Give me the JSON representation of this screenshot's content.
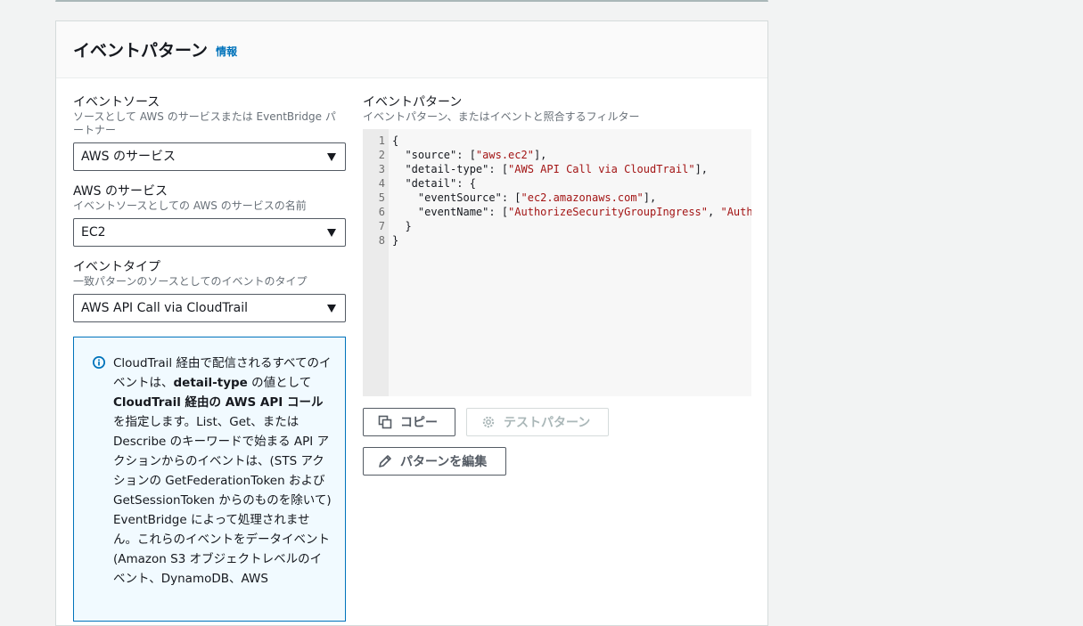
{
  "panel": {
    "title": "イベントパターン",
    "info_link": "情報"
  },
  "event_source": {
    "label": "イベントソース",
    "description": "ソースとして AWS のサービスまたは EventBridge パートナー",
    "value": "AWS のサービス"
  },
  "aws_service": {
    "label": "AWS のサービス",
    "description": "イベントソースとしての AWS のサービスの名前",
    "value": "EC2"
  },
  "event_type": {
    "label": "イベントタイプ",
    "description": "一致パターンのソースとしてのイベントのタイプ",
    "value": "AWS API Call via CloudTrail"
  },
  "info_box": {
    "parts": [
      "CloudTrail 経由で配信されるすべてのイベントは、",
      "detail-type",
      " の値として ",
      "CloudTrail 経由の AWS API コール",
      "を指定します。List、Get、または Describe のキーワードで始まる API アクションからのイベントは、(STS アクションの GetFederationToken および GetSessionToken からのものを除いて) EventBridge によって処理されません。これらのイベントをデータイベント (Amazon S3 オブジェクトレベルのイベント、DynamoDB、AWS"
    ]
  },
  "pattern": {
    "label": "イベントパターン",
    "description": "イベントパターン、またはイベントと照合するフィルター",
    "line_numbers": [
      "1",
      "2",
      "3",
      "4",
      "5",
      "6",
      "7",
      "8"
    ],
    "code": {
      "l1": "{",
      "l2_key": "  \"source\": [",
      "l2_val": "\"aws.ec2\"",
      "l2_end": "],",
      "l3_key": "  \"detail-type\": [",
      "l3_val": "\"AWS API Call via CloudTrail\"",
      "l3_end": "],",
      "l4": "  \"detail\": {",
      "l5_key": "    \"eventSource\": [",
      "l5_val": "\"ec2.amazonaws.com\"",
      "l5_end": "],",
      "l6_key": "    \"eventName\": [",
      "l6_val1": "\"AuthorizeSecurityGroupIngress\"",
      "l6_sep": ", ",
      "l6_val2": "\"Auth",
      "l7": "  }",
      "l8": "}"
    }
  },
  "buttons": {
    "copy": "コピー",
    "test": "テストパターン",
    "edit": "パターンを編集"
  },
  "colors": {
    "accent": "#0073bb",
    "string": "#a31515"
  }
}
